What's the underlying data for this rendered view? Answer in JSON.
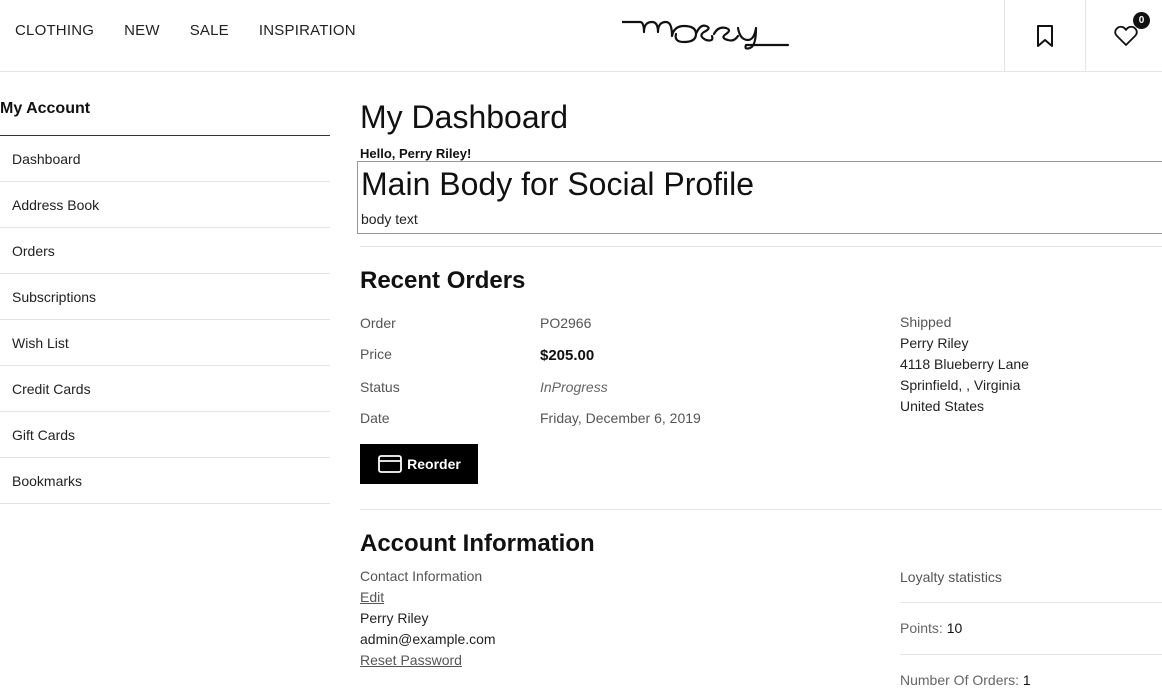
{
  "header": {
    "nav": [
      "CLOTHING",
      "NEW",
      "SALE",
      "INSPIRATION"
    ],
    "logo_text": "mosey",
    "wishlist_count": "0"
  },
  "sidebar": {
    "title": "My Account",
    "items": [
      "Dashboard",
      "Address Book",
      "Orders",
      "Subscriptions",
      "Wish List",
      "Credit Cards",
      "Gift Cards",
      "Bookmarks"
    ]
  },
  "main": {
    "title": "My Dashboard",
    "greeting": "Hello, Perry Riley!",
    "social": {
      "title": "Main Body for Social Profile",
      "body": "body text"
    },
    "recent_orders": {
      "title": "Recent Orders",
      "labels": {
        "order": "Order",
        "price": "Price",
        "status": "Status",
        "date": "Date"
      },
      "order": "PO2966",
      "price": "$205.00",
      "status": "InProgress",
      "date": "Friday, December 6, 2019",
      "shipping": {
        "status": "Shipped",
        "name": "Perry Riley",
        "street": "4118 Blueberry Lane",
        "city": "Sprinfield, , Virginia",
        "country": "United States"
      },
      "reorder_label": "Reorder"
    },
    "account": {
      "title": "Account Information",
      "contact_label": "Contact Information",
      "edit_label": "Edit",
      "name": "Perry Riley",
      "email": "admin@example.com",
      "reset_label": "Reset Password",
      "loyalty": {
        "title": "Loyalty statistics",
        "points_label": "Points:",
        "points": "10",
        "orders_label": "Number Of Orders:",
        "orders": "1"
      }
    }
  }
}
